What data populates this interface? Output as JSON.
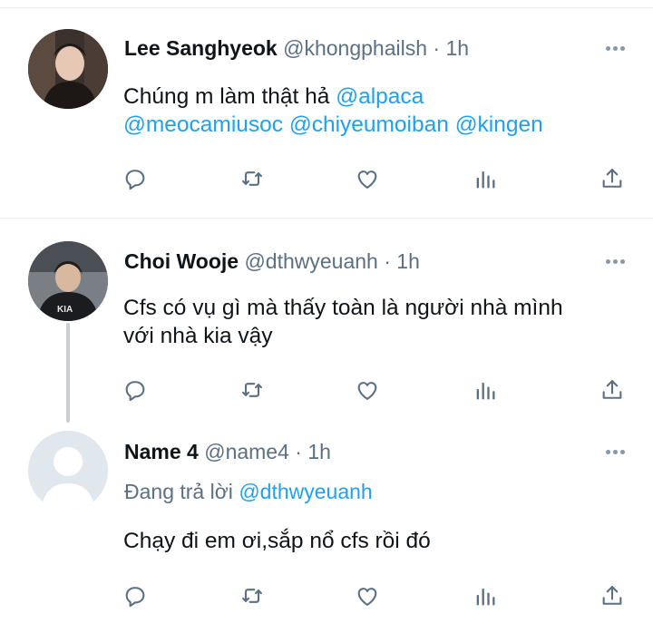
{
  "tweets": [
    {
      "author": "Lee Sanghyeok",
      "handle": "@khongphailsh",
      "dot": "·",
      "time": "1h",
      "line1_text": "Chúng m làm thật hả ",
      "line1_mention": "@alpaca",
      "line2_mentions": [
        "@meocamiusoc",
        "@chiyeumoiban",
        "@kingen"
      ],
      "avatar_icon": "user-photo-avatar"
    },
    {
      "author": "Choi Wooje",
      "handle": "@dthwyeuanh",
      "dot": "·",
      "time": "1h",
      "line1": "Cfs có vụ gì mà thấy toàn là người nhà mình",
      "line2": "với nhà kia vậy",
      "avatar_icon": "user-photo-avatar"
    },
    {
      "author": "Name 4",
      "handle": "@name4",
      "dot": "·",
      "time": "1h",
      "reply_prefix": "Đang trả lời ",
      "reply_to": "@dthwyeuanh",
      "line1": "Chạy đi em ơi,sắp nổ cfs rồi đó",
      "avatar_icon": "default-profile-avatar"
    }
  ],
  "action_icons": [
    "reply-icon",
    "retweet-icon",
    "like-icon",
    "analytics-icon",
    "share-icon"
  ],
  "colors": {
    "text": "#0f1419",
    "secondary": "#5b7083",
    "mention": "#1da1f2",
    "icon": "#8899a6",
    "divider": "#e6ecf0",
    "thread_line": "#c4cfd6"
  }
}
